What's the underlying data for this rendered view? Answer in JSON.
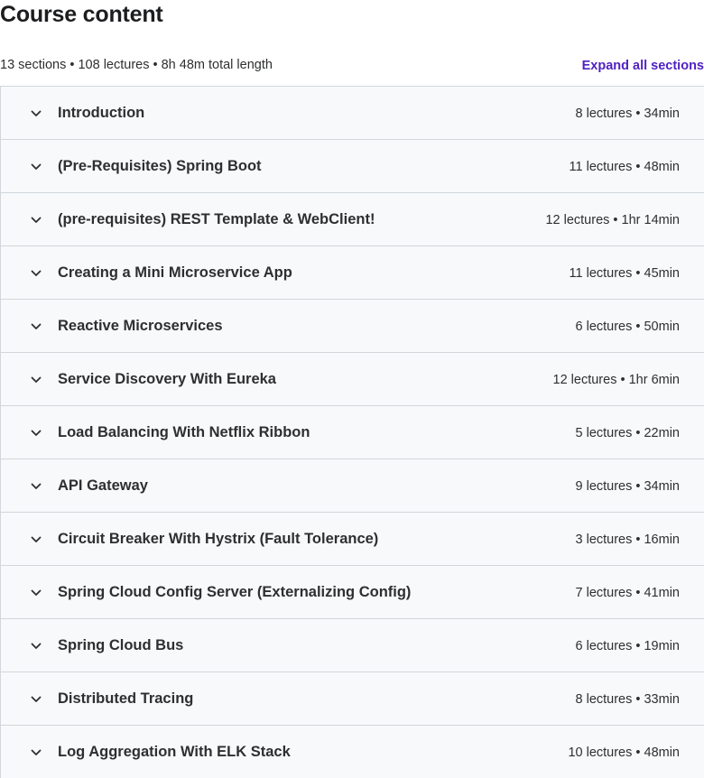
{
  "header": {
    "title": "Course content",
    "summary": "13 sections • 108 lectures • 8h 48m total length",
    "expand_all_label": "Expand all sections"
  },
  "colors": {
    "accent": "#5022c3",
    "section_bg": "#f7f9fa",
    "border": "#d1d7dc"
  },
  "sections": [
    {
      "title": "Introduction",
      "meta": "8 lectures • 34min"
    },
    {
      "title": "(Pre-Requisites) Spring Boot",
      "meta": "11 lectures • 48min"
    },
    {
      "title": "(pre-requisites) REST Template & WebClient!",
      "meta": "12 lectures • 1hr 14min"
    },
    {
      "title": "Creating a Mini Microservice App",
      "meta": "11 lectures • 45min"
    },
    {
      "title": "Reactive Microservices",
      "meta": "6 lectures • 50min"
    },
    {
      "title": "Service Discovery With Eureka",
      "meta": "12 lectures • 1hr 6min"
    },
    {
      "title": "Load Balancing With Netflix Ribbon",
      "meta": "5 lectures • 22min"
    },
    {
      "title": "API Gateway",
      "meta": "9 lectures • 34min"
    },
    {
      "title": "Circuit Breaker With Hystrix (Fault Tolerance)",
      "meta": "3 lectures • 16min"
    },
    {
      "title": "Spring Cloud Config Server (Externalizing Config)",
      "meta": "7 lectures • 41min"
    },
    {
      "title": "Spring Cloud Bus",
      "meta": "6 lectures • 19min"
    },
    {
      "title": "Distributed Tracing",
      "meta": "8 lectures • 33min"
    },
    {
      "title": "Log Aggregation With ELK Stack",
      "meta": "10 lectures • 48min"
    }
  ],
  "icons": {
    "section_toggle": "chevron-down-icon"
  }
}
